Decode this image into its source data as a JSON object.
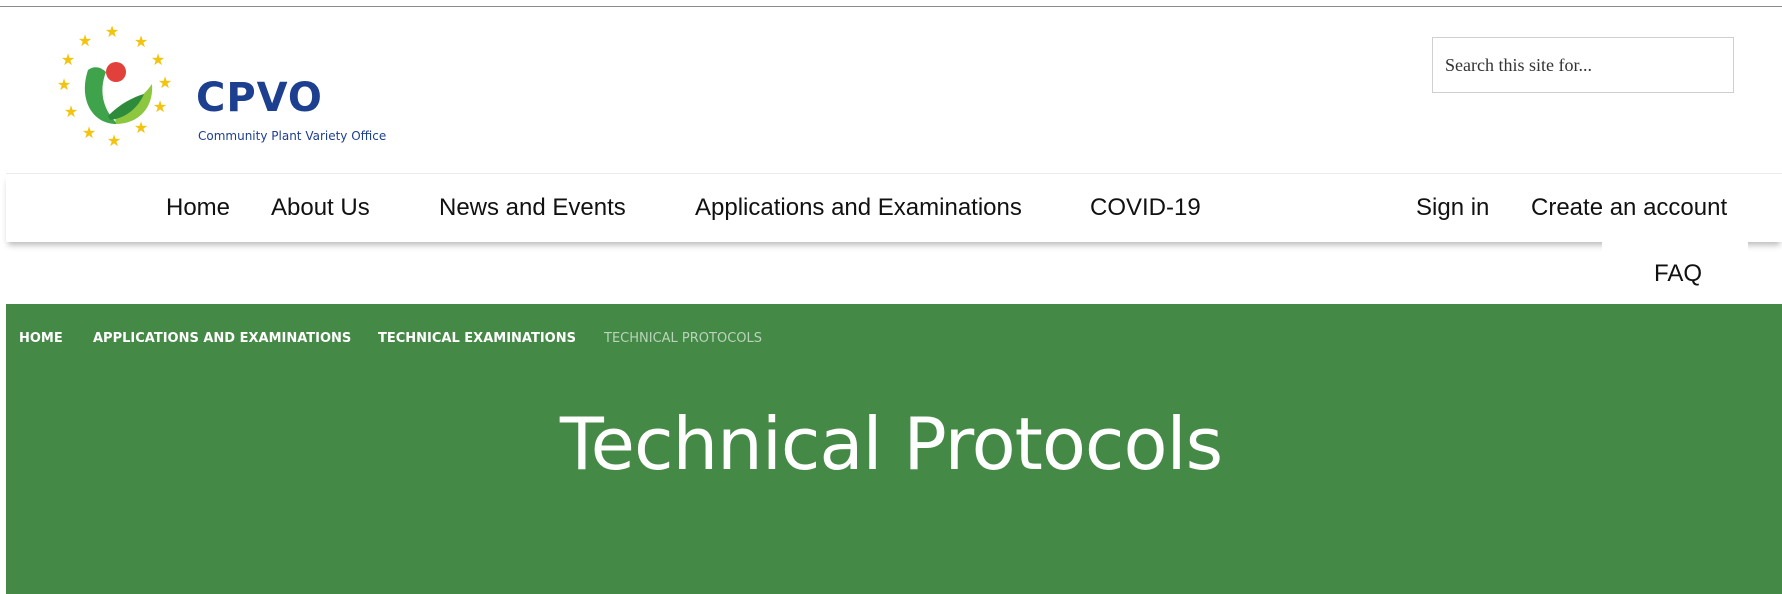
{
  "logo": {
    "wordmark": "CPVO",
    "subtitle": "Community Plant Variety Office",
    "colors": {
      "brand_blue": "#1d3f8f",
      "star_yellow": "#f2c40f",
      "leaf_green": "#3ea34a",
      "leaf_light": "#8dc63f",
      "dot_red": "#e2403a"
    }
  },
  "search": {
    "placeholder": "Search this site for..."
  },
  "nav": {
    "items": [
      {
        "label": "Home"
      },
      {
        "label": "About Us"
      },
      {
        "label": "News and Events"
      },
      {
        "label": "Applications and Examinations"
      },
      {
        "label": "COVID-19"
      }
    ],
    "sign_in": "Sign in",
    "create_account": "Create an account",
    "faq": "FAQ"
  },
  "breadcrumb": [
    {
      "label": "HOME"
    },
    {
      "label": "APPLICATIONS AND EXAMINATIONS"
    },
    {
      "label": "TECHNICAL EXAMINATIONS"
    },
    {
      "label": "TECHNICAL PROTOCOLS"
    }
  ],
  "hero": {
    "title": "Technical Protocols",
    "background": "#458946"
  }
}
